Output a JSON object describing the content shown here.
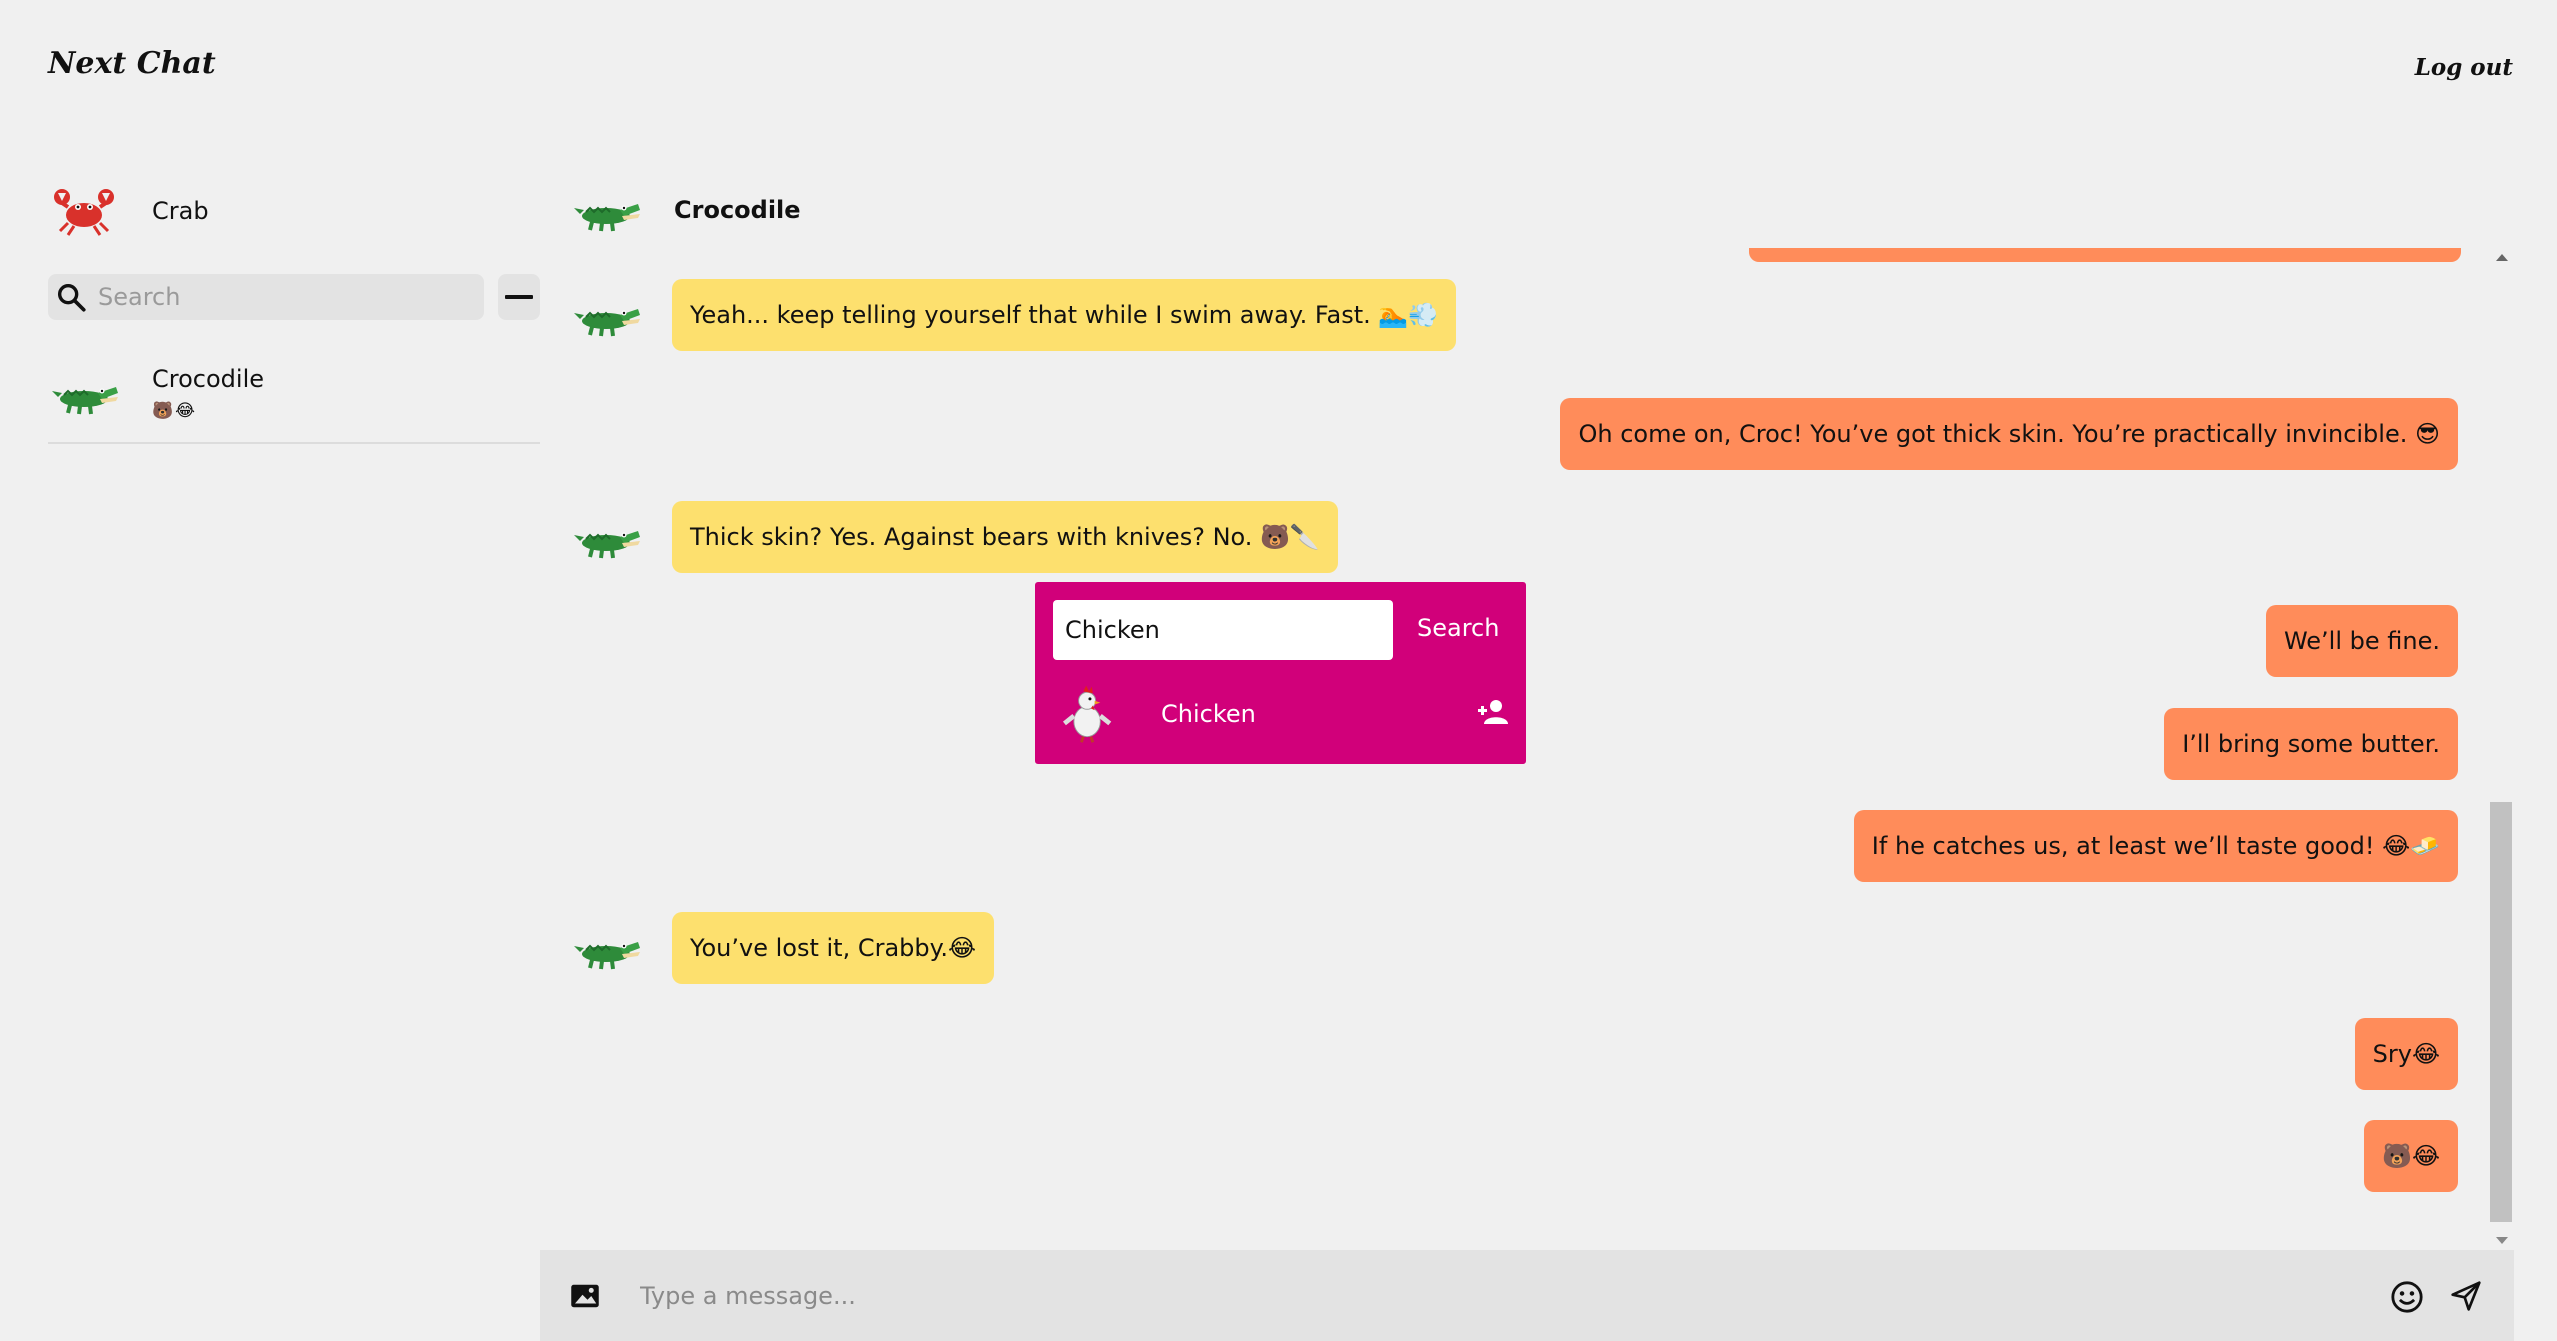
{
  "app": {
    "title": "Next Chat",
    "logout_label": "Log out"
  },
  "sidebar": {
    "current_user": {
      "name": "Crab",
      "avatar": "crab-avatar"
    },
    "search": {
      "placeholder": "Search",
      "value": ""
    },
    "contacts": [
      {
        "name": "Crocodile",
        "last_message": "🐻😂",
        "avatar": "crocodile-avatar"
      }
    ]
  },
  "chat": {
    "contact_name": "Crocodile",
    "messages": [
      {
        "from": "contact",
        "text": "Yeah... keep telling yourself that while I swim away. Fast. 🏊💨"
      },
      {
        "from": "me",
        "text": "Oh come on, Croc! You’ve got thick skin. You’re practically invincible. 😎"
      },
      {
        "from": "contact",
        "text": "Thick skin? Yes. Against bears with knives? No. 🐻🔪"
      },
      {
        "from": "me",
        "text": "We’ll be fine."
      },
      {
        "from": "me",
        "text": "I’ll bring some butter."
      },
      {
        "from": "me",
        "text": "If he catches us, at least we’ll taste good! 😂🧈"
      },
      {
        "from": "contact",
        "text": "You’ve lost it, Crabby.😂"
      },
      {
        "from": "me",
        "text": "Sry😂"
      },
      {
        "from": "me",
        "text": "🐻😂"
      }
    ]
  },
  "add_contact_popup": {
    "input_value": "Chicken",
    "search_label": "Search",
    "result": {
      "name": "Chicken",
      "avatar": "chicken-avatar"
    }
  },
  "composer": {
    "placeholder": "Type a message..."
  },
  "colors": {
    "background": "#f0f0f0",
    "incoming_bubble": "#fde06e",
    "outgoing_bubble": "#ff8c5a",
    "popup": "#d1007a",
    "input_bar": "#e3e3e3"
  }
}
